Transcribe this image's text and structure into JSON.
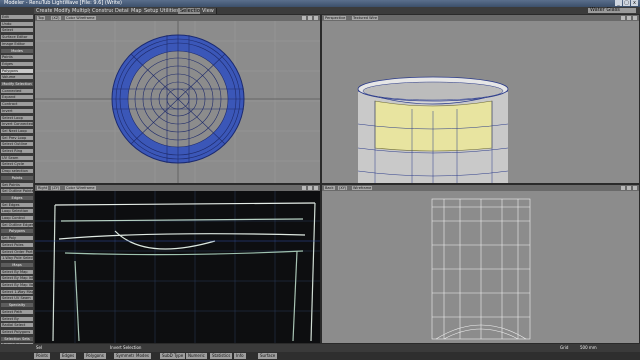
{
  "titlebar": {
    "title": "Modeler - RenuTub LightWave  [File: 9.6] (Write)",
    "min": "_",
    "max": "▢",
    "close": "x"
  },
  "menu": {
    "tabs": [
      "Create",
      "Modify",
      "Multiply",
      "Construct",
      "Detail",
      "Map",
      "Setup",
      "Utilities",
      "Selection",
      "View"
    ],
    "active": "Selection",
    "layer_dropdown": "Water Glass"
  },
  "sidebar": [
    {
      "label": "Edit",
      "header": false
    },
    {
      "label": "Undo",
      "header": false
    },
    {
      "label": "Select",
      "header": false
    },
    {
      "label": "Surface Editor",
      "header": false
    },
    {
      "label": "Image Editor",
      "header": false
    },
    {
      "label": "Modes",
      "header": true
    },
    {
      "label": "Points",
      "header": false
    },
    {
      "label": "Edges",
      "header": false
    },
    {
      "label": "Polygons",
      "header": false,
      "selected": true
    },
    {
      "label": "Volume",
      "header": false
    },
    {
      "label": "Modify Selection",
      "header": true
    },
    {
      "label": "Connected",
      "header": false
    },
    {
      "label": "Expand",
      "header": false
    },
    {
      "label": "Contract",
      "header": false
    },
    {
      "label": "Invert",
      "header": false
    },
    {
      "label": "Select Loop",
      "header": false
    },
    {
      "label": "Invert Connected",
      "header": false
    },
    {
      "label": "Sel Next Loop",
      "header": false
    },
    {
      "label": "Sel Prev Loop",
      "header": false
    },
    {
      "label": "Select Outline",
      "header": false
    },
    {
      "label": "Select Ring",
      "header": false
    },
    {
      "label": "UV Seam",
      "header": false
    },
    {
      "label": "Select Cycle",
      "header": false
    },
    {
      "label": "Drop selection",
      "header": false
    },
    {
      "label": "Points",
      "header": true
    },
    {
      "label": "Set Points",
      "header": false
    },
    {
      "label": "Sel Outline Points",
      "header": false
    },
    {
      "label": "Edges",
      "header": true
    },
    {
      "label": "Sel Edges",
      "header": false
    },
    {
      "label": "Loop Selection",
      "header": false
    },
    {
      "label": "Loop Control",
      "header": false
    },
    {
      "label": "Sel Outline Edges",
      "header": false
    },
    {
      "label": "Polygons",
      "header": true
    },
    {
      "label": "Sel Poly",
      "header": false
    },
    {
      "label": "Select Poles",
      "header": false
    },
    {
      "label": "Select Order Part",
      "header": false
    },
    {
      "label": "1-Way Pole Select",
      "header": false
    },
    {
      "label": "Maps",
      "header": true
    },
    {
      "label": "Select By Map",
      "header": false
    },
    {
      "label": "Select By Map Inf.",
      "header": false
    },
    {
      "label": "Select By Map Val.",
      "header": false
    },
    {
      "label": "Select 1-Way Map",
      "header": false
    },
    {
      "label": "Select UV Seam",
      "header": false
    },
    {
      "label": "Specialty",
      "header": true
    },
    {
      "label": "Select Path",
      "header": false
    },
    {
      "label": "Select By",
      "header": false
    },
    {
      "label": "Radial Select",
      "header": false
    },
    {
      "label": "Select Polygons",
      "header": false
    },
    {
      "label": "Selection Sets",
      "header": true
    },
    {
      "label": "Select Sets",
      "header": false
    }
  ],
  "viewports": {
    "top": {
      "view": "Top",
      "axis": "(XZ)",
      "mode": "Color Wireframe"
    },
    "perspective": {
      "view": "Perspective",
      "mode": "Textured Wire"
    },
    "right": {
      "view": "Right",
      "axis": "(ZY)",
      "mode": "Color Wireframe"
    },
    "back": {
      "view": "Back",
      "axis": "(XY)",
      "mode": "Wireframe"
    }
  },
  "status": {
    "message": "Invert Selection",
    "grid": "Grid",
    "grid_value": "500 mm",
    "sel": "Sel"
  },
  "bottombar": [
    {
      "label": "Points"
    },
    {
      "label": "Edges"
    },
    {
      "label": "Polygons"
    },
    {
      "label": "Symmetry"
    },
    {
      "label": "Modes"
    },
    {
      "label": "SubD Type"
    },
    {
      "label": "Numeric"
    },
    {
      "label": "Statistics"
    },
    {
      "label": "Info"
    },
    {
      "label": "Surface"
    }
  ],
  "colors": {
    "accent": "#3b57b8",
    "selected_poly": "#e8e4a0",
    "wire": "#1e2a6a"
  }
}
